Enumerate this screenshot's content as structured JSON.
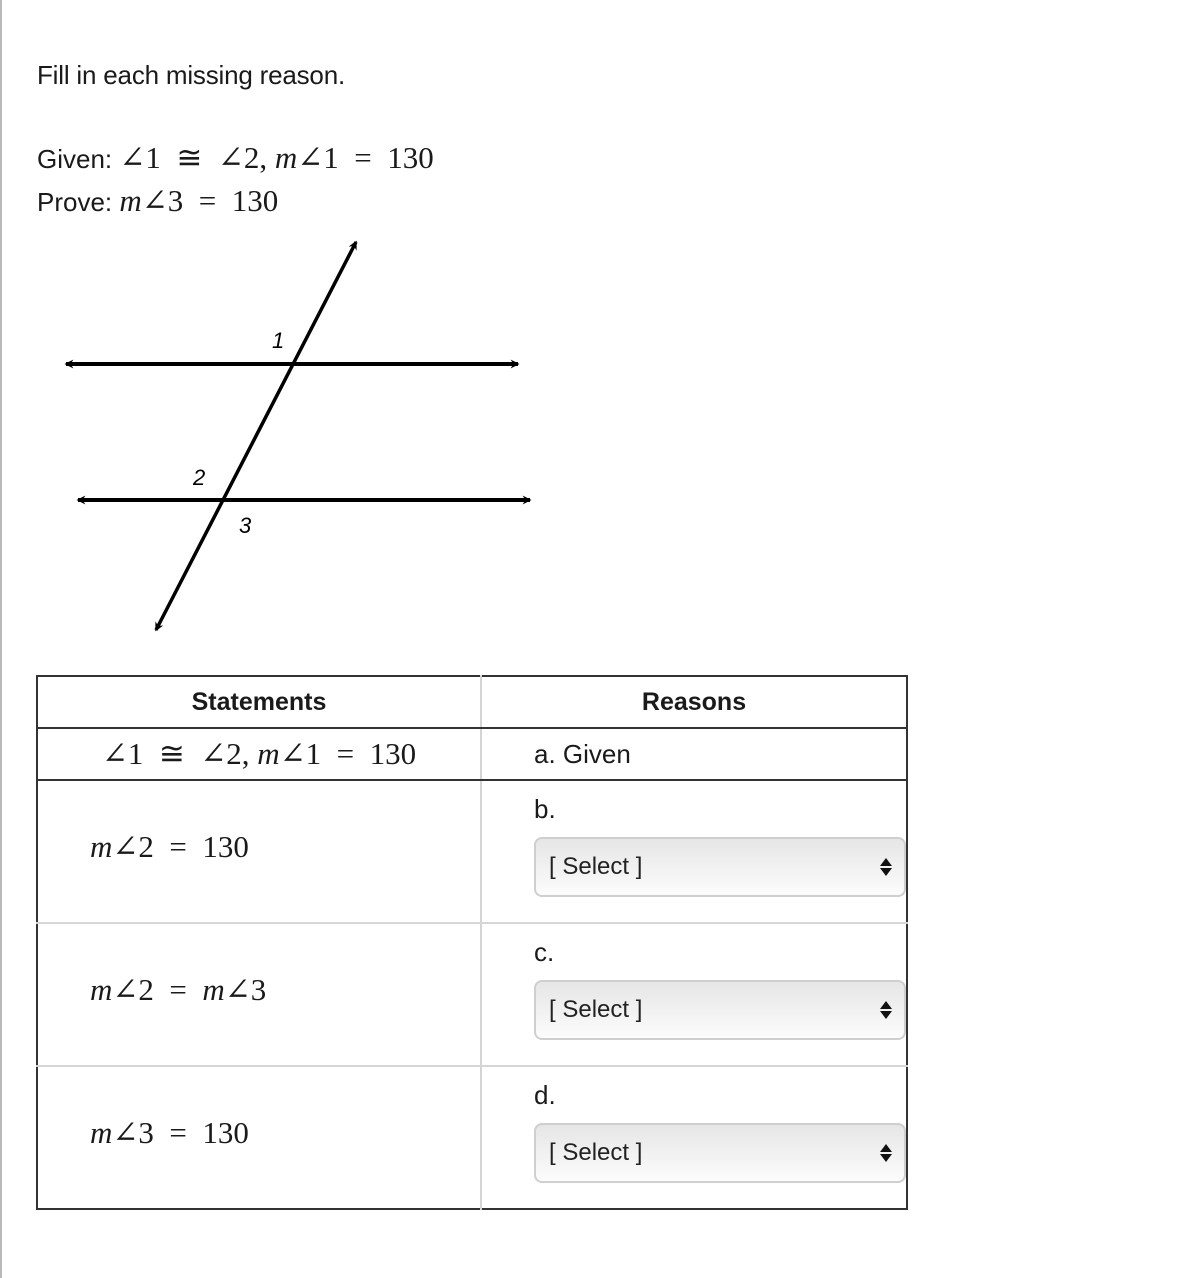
{
  "instructions": "Fill in each missing reason.",
  "given": {
    "label": "Given:",
    "parts": [
      "∠1",
      "≅",
      "∠2,",
      "m",
      "∠1",
      "=",
      "130"
    ]
  },
  "prove": {
    "label": "Prove:",
    "parts": [
      "m",
      "∠3",
      "=",
      "130"
    ]
  },
  "diagram": {
    "angle_labels": [
      "1",
      "2",
      "3"
    ]
  },
  "table": {
    "headers": {
      "statements": "Statements",
      "reasons": "Reasons"
    },
    "rows": [
      {
        "statement": [
          "∠1",
          "≅",
          "∠2,",
          "m",
          "∠1",
          "=",
          "130"
        ],
        "letter": "a.",
        "reason": "Given"
      },
      {
        "statement": [
          "m",
          "∠2",
          "=",
          "130"
        ],
        "letter": "b.",
        "select": "[ Select ]"
      },
      {
        "statement": [
          "m",
          "∠2",
          "=",
          "m",
          "∠3"
        ],
        "letter": "c.",
        "select": "[ Select ]"
      },
      {
        "statement": [
          "m",
          "∠3",
          "=",
          "130"
        ],
        "letter": "d.",
        "select": "[ Select ]"
      }
    ]
  }
}
